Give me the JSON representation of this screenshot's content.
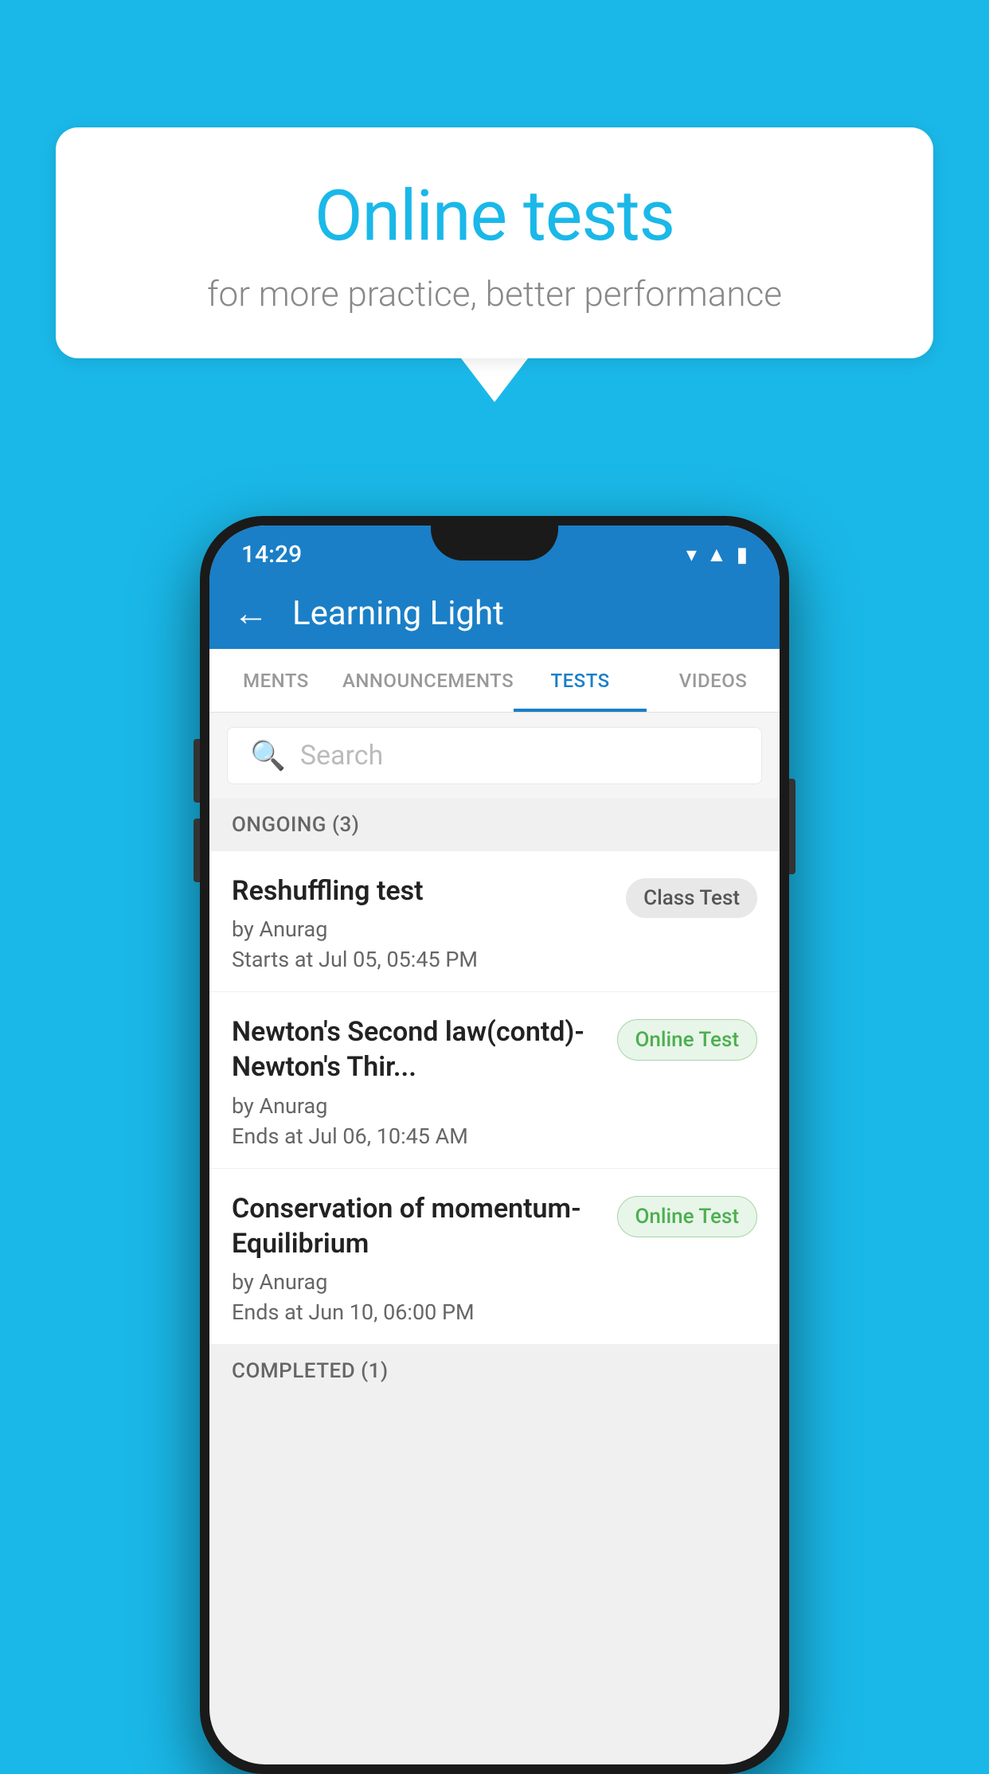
{
  "background_color": "#1ab8e8",
  "speech_bubble": {
    "title": "Online tests",
    "subtitle": "for more practice, better performance"
  },
  "phone": {
    "status_bar": {
      "time": "14:29",
      "icons": [
        "wifi",
        "signal",
        "battery"
      ]
    },
    "header": {
      "title": "Learning Light",
      "back_label": "←"
    },
    "tabs": [
      {
        "label": "MENTS",
        "active": false
      },
      {
        "label": "ANNOUNCEMENTS",
        "active": false
      },
      {
        "label": "TESTS",
        "active": true
      },
      {
        "label": "VIDEOS",
        "active": false
      }
    ],
    "search": {
      "placeholder": "Search"
    },
    "sections": [
      {
        "title": "ONGOING (3)",
        "tests": [
          {
            "name": "Reshuffling test",
            "author": "by Anurag",
            "date": "Starts at  Jul 05, 05:45 PM",
            "badge": "Class Test",
            "badge_type": "class"
          },
          {
            "name": "Newton's Second law(contd)-Newton's Thir...",
            "author": "by Anurag",
            "date": "Ends at  Jul 06, 10:45 AM",
            "badge": "Online Test",
            "badge_type": "online"
          },
          {
            "name": "Conservation of momentum-Equilibrium",
            "author": "by Anurag",
            "date": "Ends at  Jun 10, 06:00 PM",
            "badge": "Online Test",
            "badge_type": "online"
          }
        ]
      }
    ],
    "completed_section": "COMPLETED (1)"
  }
}
